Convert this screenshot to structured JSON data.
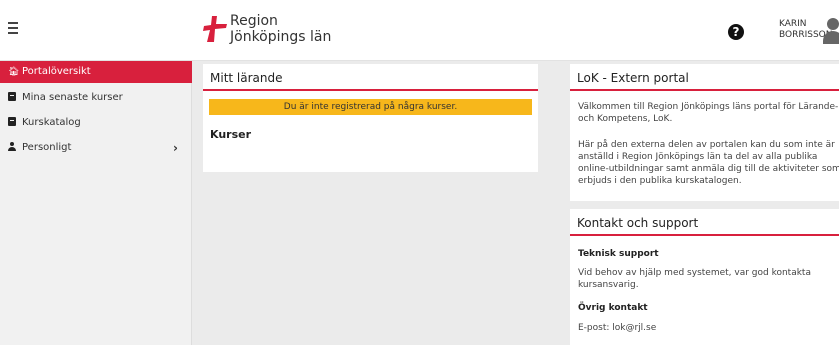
{
  "header": {
    "menu_icon": "hamburger-icon",
    "logo_line1": "Region",
    "logo_line2": "Jönköpings län",
    "help_icon": "question-circle-icon",
    "help_glyph": "?",
    "user_first": "KARIN",
    "user_last": "BORRISSON",
    "avatar_icon": "user-avatar-icon"
  },
  "sidebar": {
    "items": [
      {
        "label": "Portalöversikt",
        "icon": "home-icon",
        "active": true
      },
      {
        "label": "Mina senaste kurser",
        "icon": "book-icon"
      },
      {
        "label": "Kurskatalog",
        "icon": "book-icon"
      },
      {
        "label": "Personligt",
        "icon": "user-icon",
        "chevron": "›"
      }
    ]
  },
  "main": {
    "title": "Mitt lärande",
    "alert": "Du är inte registrerad på några kurser.",
    "courses_heading": "Kurser"
  },
  "portal": {
    "title": "LoK - Extern portal",
    "para1": "Välkommen till Region Jönköpings läns portal för Lärande- och Kompetens, LoK.",
    "para2": "Här på den externa delen av portalen kan du som inte är anställd i Region Jönköpings län ta del av alla publika online-utbildningar samt anmäla dig till de aktiviteter som erbjuds i den publika kurskatalogen."
  },
  "contact": {
    "title": "Kontakt och support",
    "tech_heading": "Teknisk support",
    "tech_text": "Vid behov av hjälp med systemet, var god kontakta kursansvarig.",
    "other_heading": "Övrig kontakt",
    "email": "E-post: lok@rjl.se"
  },
  "colors": {
    "accent": "#d8203d",
    "alert": "#f7b71b"
  }
}
